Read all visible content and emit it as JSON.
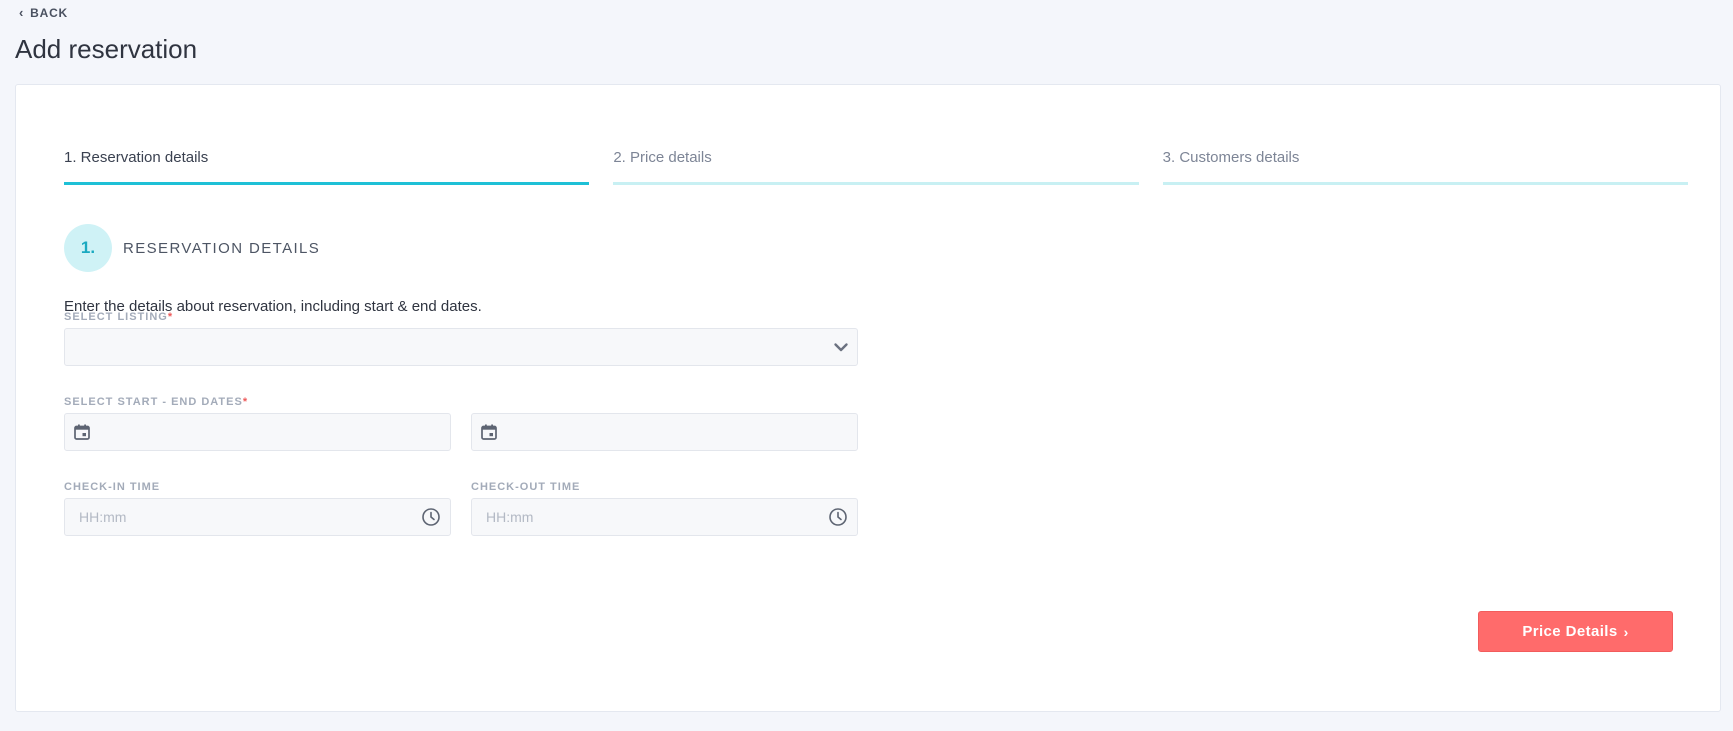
{
  "header": {
    "back_label": "BACK",
    "page_title": "Add reservation"
  },
  "steps": [
    {
      "label": "1. Reservation details",
      "active": true
    },
    {
      "label": "2. Price details",
      "active": false
    },
    {
      "label": "3. Customers details",
      "active": false
    }
  ],
  "section": {
    "number": "1.",
    "title": "RESERVATION DETAILS",
    "intro": "Enter the details about reservation, including start & end dates."
  },
  "form": {
    "listing_label": "SELECT LISTING",
    "listing_value": "",
    "dates_label": "SELECT START - END DATES",
    "start_date_value": "",
    "end_date_value": "",
    "required_mark": "*",
    "checkin_label": "CHECK-IN TIME",
    "checkin_placeholder": "HH:mm",
    "checkout_label": "CHECK-OUT TIME",
    "checkout_placeholder": "HH:mm"
  },
  "actions": {
    "next_label": "Price Details",
    "next_icon": "chevron-right-icon"
  },
  "colors": {
    "accent": "#1ec0d6",
    "accent_light": "#c8f0f3",
    "primary_button": "#ff6b6b",
    "required": "#ee5a5a"
  }
}
